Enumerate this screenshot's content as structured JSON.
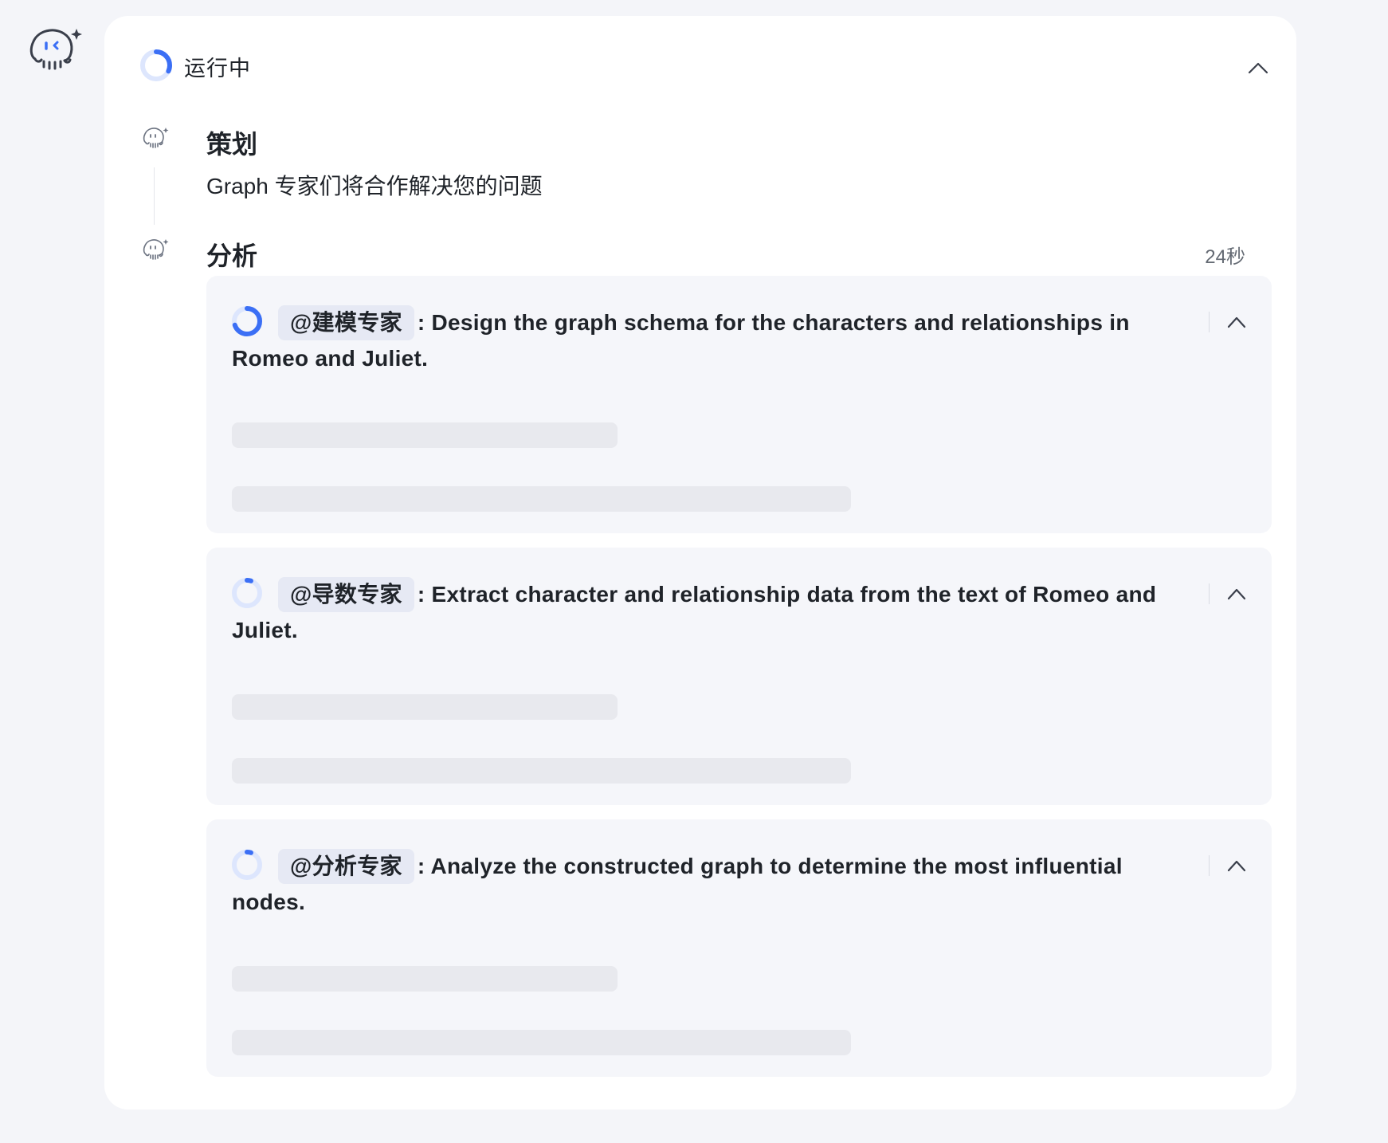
{
  "status": {
    "label": "运行中"
  },
  "steps": [
    {
      "title": "策划",
      "description": "Graph 专家们将合作解决您的问题"
    },
    {
      "title": "分析",
      "time": "24秒"
    }
  ],
  "tasks": [
    {
      "agent": "@建模专家",
      "text": ": Design the graph schema for the characters and relationships in Romeo and Juliet.",
      "progress": 0.7
    },
    {
      "agent": "@导数专家",
      "text": ": Extract character and relationship data from the text of Romeo and Juliet.",
      "progress": 0.05
    },
    {
      "agent": "@分析专家",
      "text": ": Analyze the constructed graph to determine the most influential nodes.",
      "progress": 0.05
    }
  ],
  "colors": {
    "accent": "#3b6ff5",
    "accent_light": "#dde6fd",
    "page_bg": "#f4f5f9",
    "card_bg": "#ffffff",
    "task_bg": "#f5f6fa",
    "skeleton": "#e8e9ee"
  },
  "icons": {
    "assistant": "octopus-assistant-icon",
    "collapse": "chevron-up-icon",
    "status": "spinner-icon"
  }
}
